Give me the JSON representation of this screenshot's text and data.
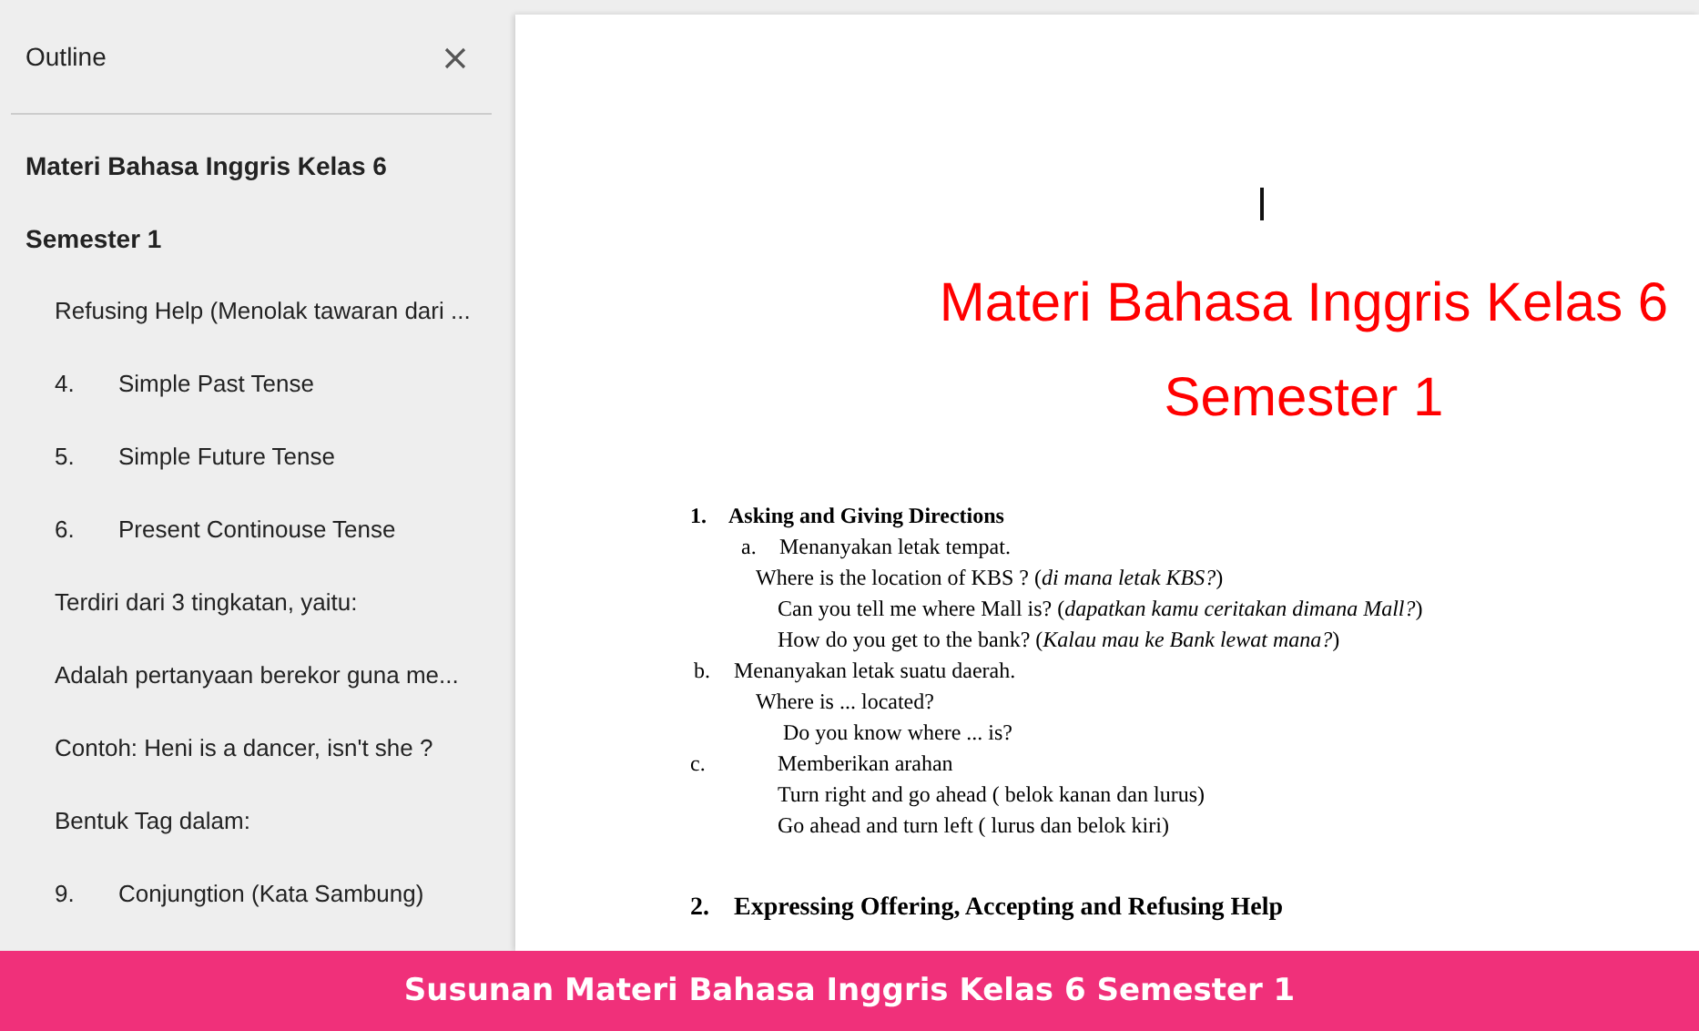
{
  "outline": {
    "title": "Outline",
    "items": [
      {
        "text": "Materi Bahasa Inggris Kelas 6"
      },
      {
        "text": "Semester 1",
        "children": [
          {
            "text": "Refusing Help (Menolak tawaran dari ..."
          },
          {
            "number": "4.",
            "text": "Simple Past Tense"
          },
          {
            "number": "5.",
            "text": "Simple Future Tense"
          },
          {
            "number": "6.",
            "text": "Present Continouse Tense"
          },
          {
            "text": "Terdiri dari 3 tingkatan, yaitu:"
          },
          {
            "text": "Adalah pertanyaan berekor guna me..."
          },
          {
            "text": "Contoh: Heni is a dancer, isn't she ?"
          },
          {
            "text": "Bentuk Tag dalam:"
          },
          {
            "number": "9.",
            "text": "Conjungtion (Kata Sambung)"
          }
        ]
      }
    ]
  },
  "document": {
    "title": [
      "Materi Bahasa Inggris Kelas 6",
      "Semester 1"
    ],
    "lines": [
      {
        "kind": "heading",
        "marker": "1.",
        "text": "Asking and Giving Directions"
      },
      {
        "kind": "item-a",
        "marker": "a.",
        "text": "Menanyakan letak tempat."
      },
      {
        "kind": "line",
        "text": "Where is the location of KBS ? (*di mana letak KBS?*)"
      },
      {
        "kind": "line-deep",
        "text": "Can you tell me where Mall is? (*dapatkan kamu ceritakan dimana Mall?*)"
      },
      {
        "kind": "line-deep",
        "text": "How do you get to the bank? (*Kalau mau ke Bank lewat mana?*)"
      },
      {
        "kind": "item-b",
        "marker": "b.",
        "text": "Menanyakan letak suatu daerah."
      },
      {
        "kind": "line",
        "text": "Where is ... located?"
      },
      {
        "kind": "line-deeper",
        "text": "Do you know where ... is?"
      },
      {
        "kind": "item-c",
        "marker": "c.",
        "text": "Memberikan arahan"
      },
      {
        "kind": "line-deep",
        "text": "Turn right and go ahead ( belok kanan dan lurus)"
      },
      {
        "kind": "line-deep",
        "text": "Go ahead and turn left ( lurus dan belok kiri)"
      },
      {
        "kind": "heading2",
        "marker": "2.",
        "text": "Expressing Offering, Accepting and Refusing Help"
      }
    ]
  },
  "banner": "Susunan Materi Bahasa Inggris Kelas 6 Semester 1"
}
